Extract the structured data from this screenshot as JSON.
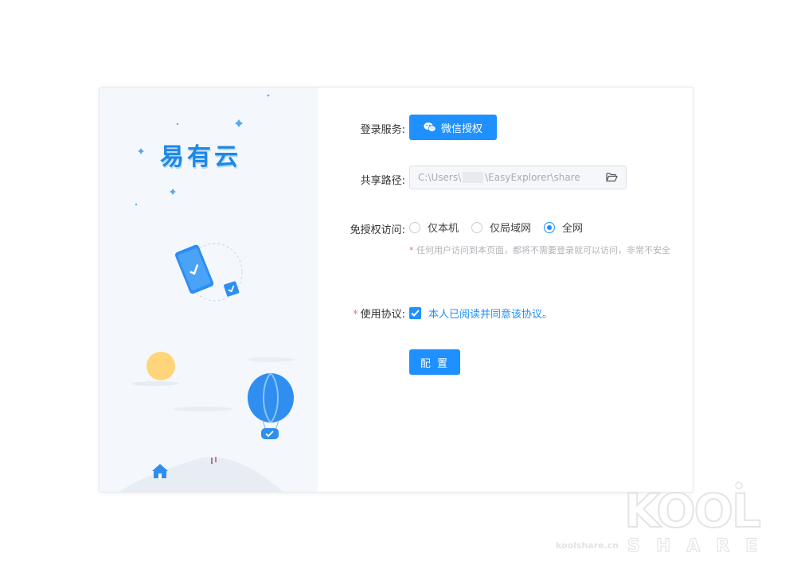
{
  "brand": {
    "name": "易有云"
  },
  "form": {
    "login_service": {
      "label": "登录服务:",
      "button_label": "微信授权"
    },
    "share_path": {
      "label": "共享路径:",
      "value_prefix": "C:\\Users\\",
      "value_suffix": "\\EasyExplorer\\share",
      "icon": "folder-open-icon"
    },
    "access": {
      "label": "免授权访问:",
      "options": [
        "仅本机",
        "仅局域网",
        "全网"
      ],
      "selected": "全网",
      "hint_star": "*",
      "hint": "任何用户访问到本页面，都将不需要登录就可以访问，非常不安全"
    },
    "agreement": {
      "required_mark": "*",
      "label": "使用协议:",
      "checked": true,
      "text": "本人已阅读并同意该协议。"
    },
    "submit_label": "配 置"
  },
  "watermark": {
    "big": "KOOL",
    "sub": "SHARE",
    "small": "koolshare.cn"
  },
  "colors": {
    "primary": "#1e90ff",
    "danger": "#f56c6c",
    "left_panel": "#f4f8fd"
  }
}
